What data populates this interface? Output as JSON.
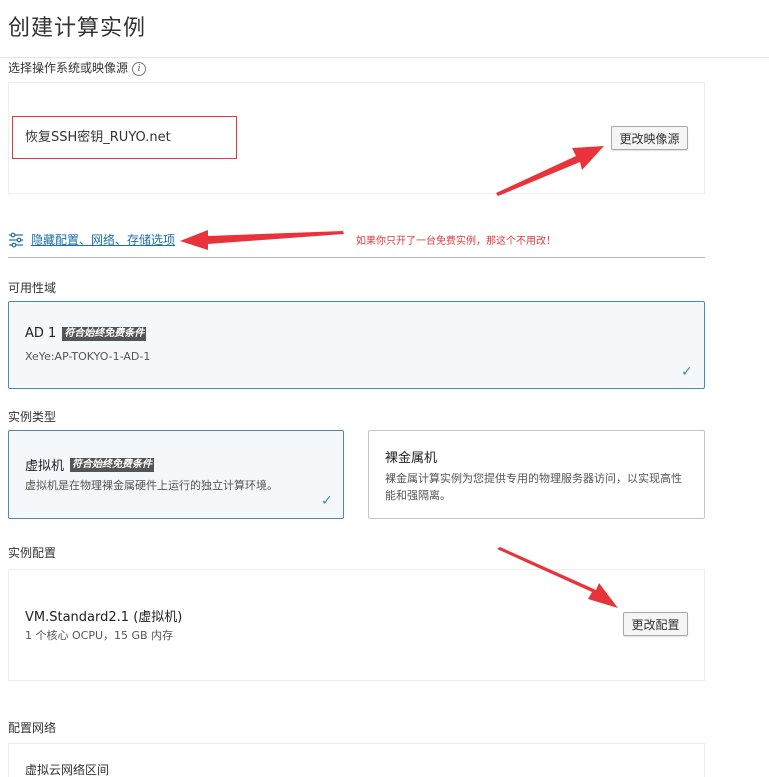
{
  "page": {
    "title": "创建计算实例"
  },
  "image_source": {
    "label": "选择操作系统或映像源",
    "info_icon": "i",
    "selected_image": "恢复SSH密钥_RUYO.net",
    "change_button": "更改映像源"
  },
  "advanced": {
    "link": "隐藏配置、网络、存储选项",
    "annotation": "如果你只开了一台免费实例，那这个不用改！"
  },
  "availability_domain": {
    "label": "可用性域",
    "card": {
      "title": "AD 1",
      "tag": "符合始终免费条件",
      "sub": "XeYe:AP-TOKYO-1-AD-1"
    }
  },
  "instance_type": {
    "label": "实例类型",
    "vm": {
      "title": "虚拟机",
      "tag": "符合始终免费条件",
      "desc": "虚拟机是在物理裸金属硬件上运行的独立计算环境。"
    },
    "bare_metal": {
      "title": "裸金属机",
      "desc": "裸金属计算实例为您提供专用的物理服务器访问，以实现高性能和强隔离。"
    }
  },
  "instance_config": {
    "label": "实例配置",
    "shape": "VM.Standard2.1 (虚拟机)",
    "spec": "1 个核心 OCPU，15 GB 内存",
    "change_button": "更改配置"
  },
  "network": {
    "label": "配置网络",
    "vcn_label": "虚拟云网络区间"
  },
  "colors": {
    "accent": "#4c88b8",
    "link": "#1a6fa8",
    "annotation_red": "#e03a3a"
  }
}
